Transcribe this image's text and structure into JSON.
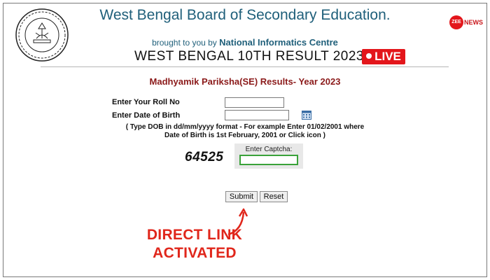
{
  "header": {
    "title": "West Bengal Board of Secondary Education.",
    "brought_prefix": "brought to you by",
    "brought_org": "National Informatics Centre",
    "result_title": "WEST BENGAL 10TH RESULT 2023",
    "live_label": "LIVE",
    "watermark": "ZEE NEWS"
  },
  "form": {
    "subtitle": "Madhyamik Pariksha(SE) Results- Year 2023",
    "roll_label": "Enter Your Roll No",
    "roll_value": "",
    "dob_label": "Enter Date of Birth",
    "dob_value": "",
    "hint_line1": "( Type DOB in dd/mm/yyyy format - For example Enter 01/02/2001 where",
    "hint_line2": "Date of Birth is 1st February, 2001 or Click icon   )",
    "captcha_code": "64525",
    "captcha_label": "Enter Captcha:",
    "captcha_value": "",
    "submit_label": "Submit",
    "reset_label": "Reset"
  },
  "annotation": {
    "line1": "DIRECT LINK",
    "line2": "ACTIVATED",
    "color": "#e0261b"
  },
  "icons": {
    "seal": "board-seal-icon",
    "calendar": "calendar-icon",
    "arrow": "arrow-icon"
  }
}
